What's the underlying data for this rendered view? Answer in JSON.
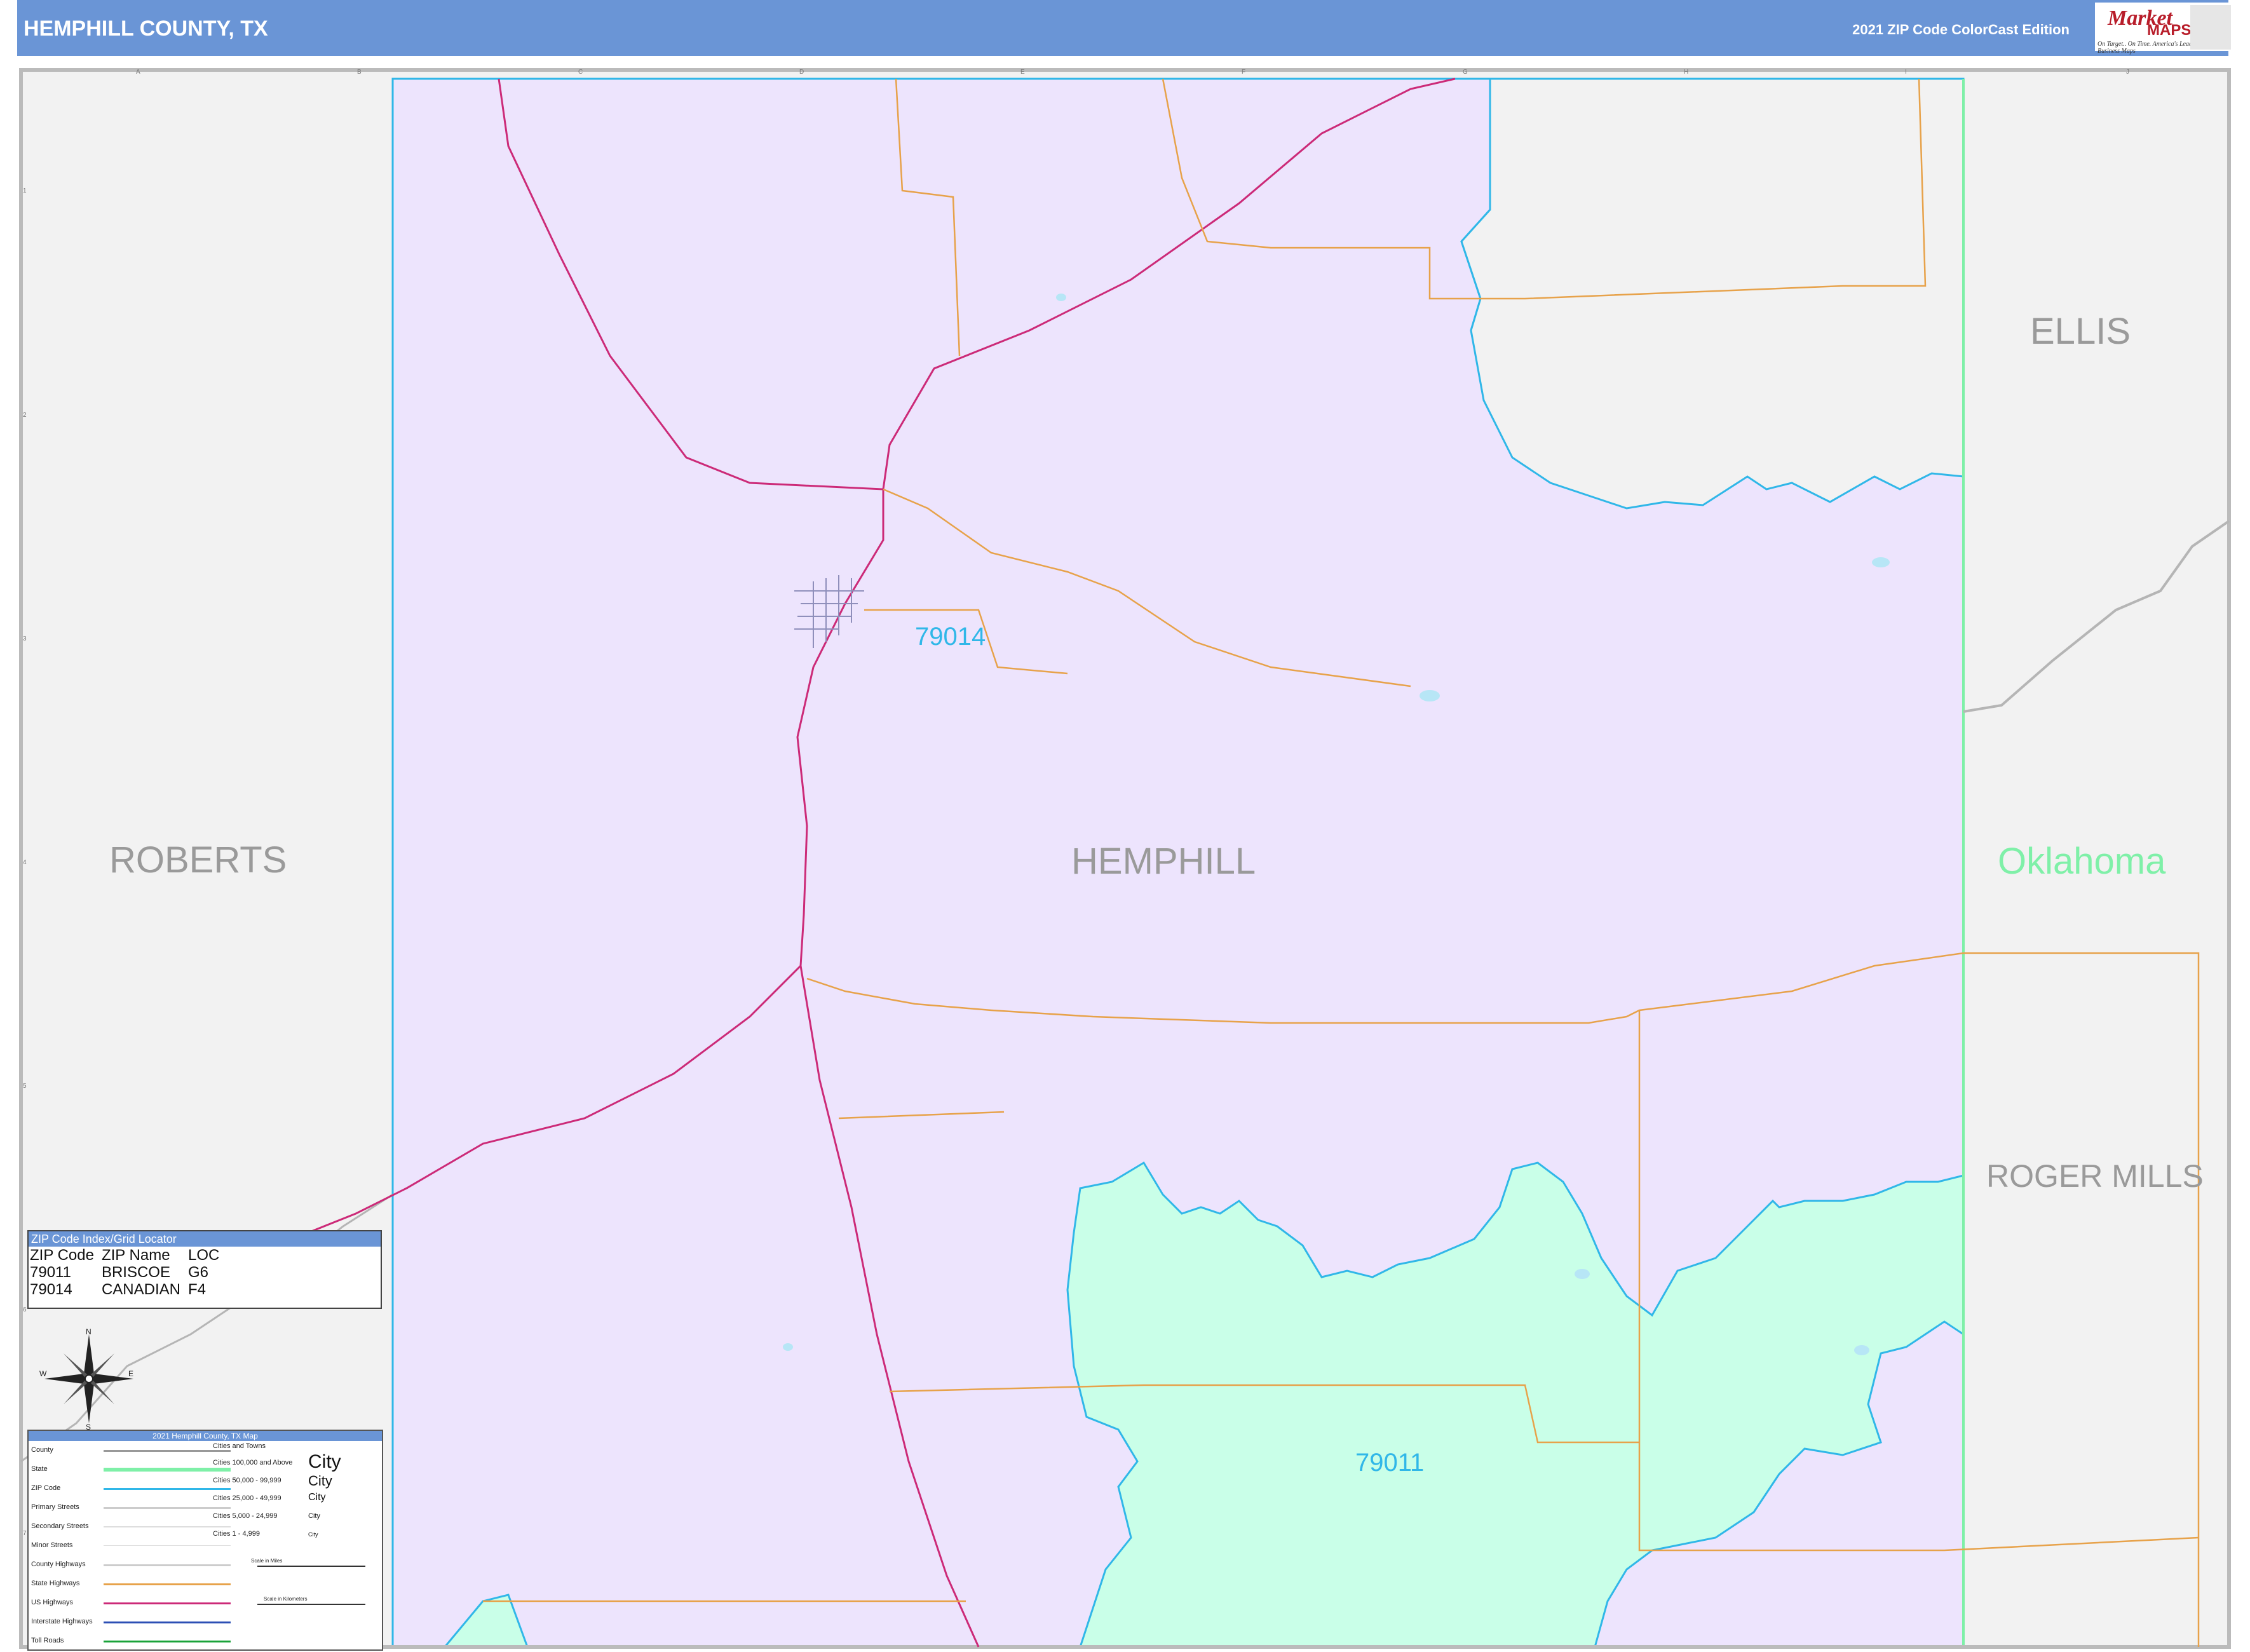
{
  "header": {
    "title": "HEMPHILL COUNTY, TX",
    "edition": "2021 ZIP Code ColorCast Edition"
  },
  "logo": {
    "brand_top": "Market",
    "brand_bottom": "MAPS",
    "tagline": "On Target.. On Time. America's Leading Source of Business Maps"
  },
  "grid": {
    "columns": [
      "A",
      "B",
      "C",
      "D",
      "E",
      "F",
      "G",
      "H",
      "I",
      "J"
    ],
    "rows": [
      "1",
      "2",
      "3",
      "4",
      "5",
      "6",
      "7"
    ]
  },
  "map_labels": {
    "counties": {
      "roberts": "ROBERTS",
      "hemphill": "HEMPHILL",
      "ellis": "ELLIS",
      "roger_mills": "ROGER MILLS"
    },
    "state": "Oklahoma",
    "zips": {
      "z79014": "79014",
      "z79011": "79011"
    }
  },
  "zip_index": {
    "title": "ZIP Code Index/Grid Locator",
    "columns": [
      "ZIP Code",
      "ZIP Name",
      "LOC"
    ],
    "rows": [
      [
        "79011",
        "BRISCOE",
        "G6"
      ],
      [
        "79014",
        "CANADIAN",
        "F4"
      ]
    ]
  },
  "compass": {
    "n": "N",
    "s": "S",
    "e": "E",
    "w": "W"
  },
  "legend": {
    "title": "2021 Hemphill County, TX Map",
    "items": [
      "County",
      "State",
      "ZIP Code",
      "Primary Streets",
      "Secondary Streets",
      "Minor Streets",
      "County Highways",
      "State Highways",
      "US Highways",
      "Interstate Highways",
      "Toll Roads"
    ],
    "cities_title": "Cities and Towns",
    "city_sizes": [
      "Cities 100,000 and Above",
      "Cities 50,000 - 99,999",
      "Cities 25,000 - 49,999",
      "Cities 5,000 - 24,999",
      "Cities 1 - 4,999"
    ],
    "city_samples": [
      "City",
      "City",
      "City",
      "City",
      "City"
    ],
    "scale_miles": "Scale in Miles",
    "scale_km": "Scale in Kilometers"
  },
  "colors": {
    "header": "#6a95d6",
    "zip_79014": "#ede4fd",
    "zip_79011": "#c9ffe8",
    "outside": "#f2f2f2",
    "zip_boundary": "#30b7e8",
    "state_boundary": "#7ff0a8",
    "us_highway": "#cc2a78",
    "state_highway": "#e7a24a"
  }
}
